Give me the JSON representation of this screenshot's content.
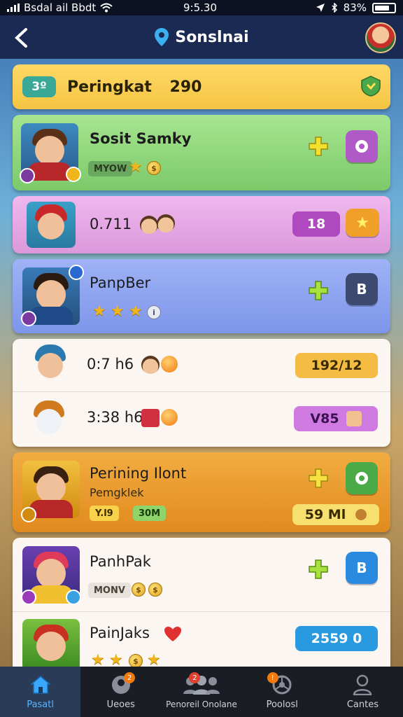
{
  "status_bar": {
    "carrier": "Bsdal ail Bbdt",
    "time": "9:5.30",
    "battery": "83%"
  },
  "header": {
    "title": "Sonslnai"
  },
  "rank_banner": {
    "badge": "3º",
    "label": "Peringkat",
    "value": "290"
  },
  "cards": [
    {
      "title": "Sosit Samky",
      "tag": "MYOW"
    },
    {
      "title": "0.711",
      "pill_a": "18"
    },
    {
      "title": "PanpBer"
    },
    {
      "title": "0:7 h6",
      "pill": "192/12"
    },
    {
      "title": "3:38 h6",
      "pill": "V85"
    },
    {
      "title": "Perining Ilont",
      "subtitle": "Pemgklek",
      "tag_a": "Y.l9",
      "tag_b": "30M",
      "pill": "59 Ml"
    },
    {
      "title": "PanhPak",
      "tag": "MONV"
    },
    {
      "title": "PainJaks",
      "pill": "2559 0"
    }
  ],
  "bottom_nav": [
    {
      "label": "Pasatl",
      "active": true
    },
    {
      "label": "Ueoes",
      "active": false
    },
    {
      "label": "Penoreil Onolane",
      "active": false
    },
    {
      "label": "Poolosl",
      "active": false
    },
    {
      "label": "Cantes",
      "active": false
    }
  ],
  "colors": {
    "header": "#1b2a52",
    "rank": "#f4c542",
    "green_card": "#8fd67a",
    "pink_card": "#e6a8e4",
    "blue_card": "#8fa4f0",
    "white_card": "#fbf6f2",
    "orange_card": "#e99a2c",
    "nav_active": "#58b6ff"
  }
}
